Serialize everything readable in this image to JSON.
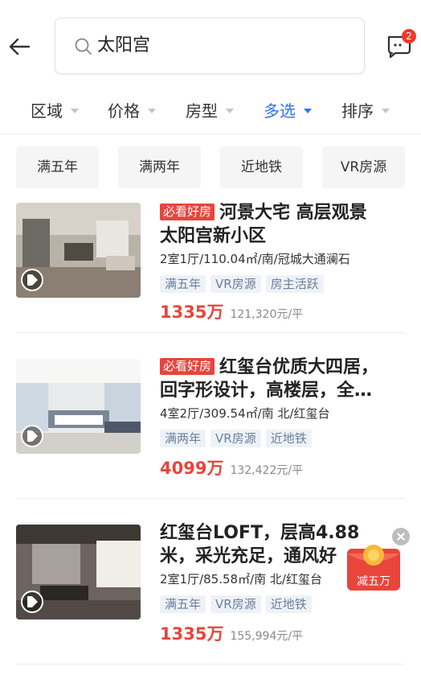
{
  "search": {
    "query": "太阳宫"
  },
  "messages": {
    "badge": "2"
  },
  "filters": [
    "区域",
    "价格",
    "房型",
    "多选",
    "排序"
  ],
  "chips": [
    "满五年",
    "满两年",
    "近地铁",
    "VR房源"
  ],
  "listings": [
    {
      "tag": "必看好房",
      "title_line1": "河景大宅 高层观景",
      "title_line2": "太阳宫新小区",
      "meta": "2室1厅/110.04㎡/南/冠城大通澜石",
      "tags": [
        "满五年",
        "VR房源",
        "房主活跃"
      ],
      "price": "1335万",
      "unit_price": "121,320元/平"
    },
    {
      "tag": "必看好房",
      "title_line1": "红玺台优质大四居，",
      "title_line2": "回字形设计，高楼层，全…",
      "meta": "4室2厅/309.54㎡/南 北/红玺台",
      "tags": [
        "满两年",
        "VR房源",
        "近地铁"
      ],
      "price": "4099万",
      "unit_price": "132,422元/平"
    },
    {
      "title_line1": "红玺台LOFT，层高4.88",
      "title_line2": "米，采光充足，通风好",
      "meta": "2室1厅/85.58㎡/南 北/红玺台",
      "tags": [
        "满五年",
        "VR房源",
        "近地铁"
      ],
      "price": "1335万",
      "unit_price": "155,994元/平"
    }
  ],
  "coupon": {
    "label": "减五万"
  },
  "colors": {
    "accent": "#3072f6",
    "price": "#e8453c",
    "tag_bg": "#eef2f8"
  }
}
